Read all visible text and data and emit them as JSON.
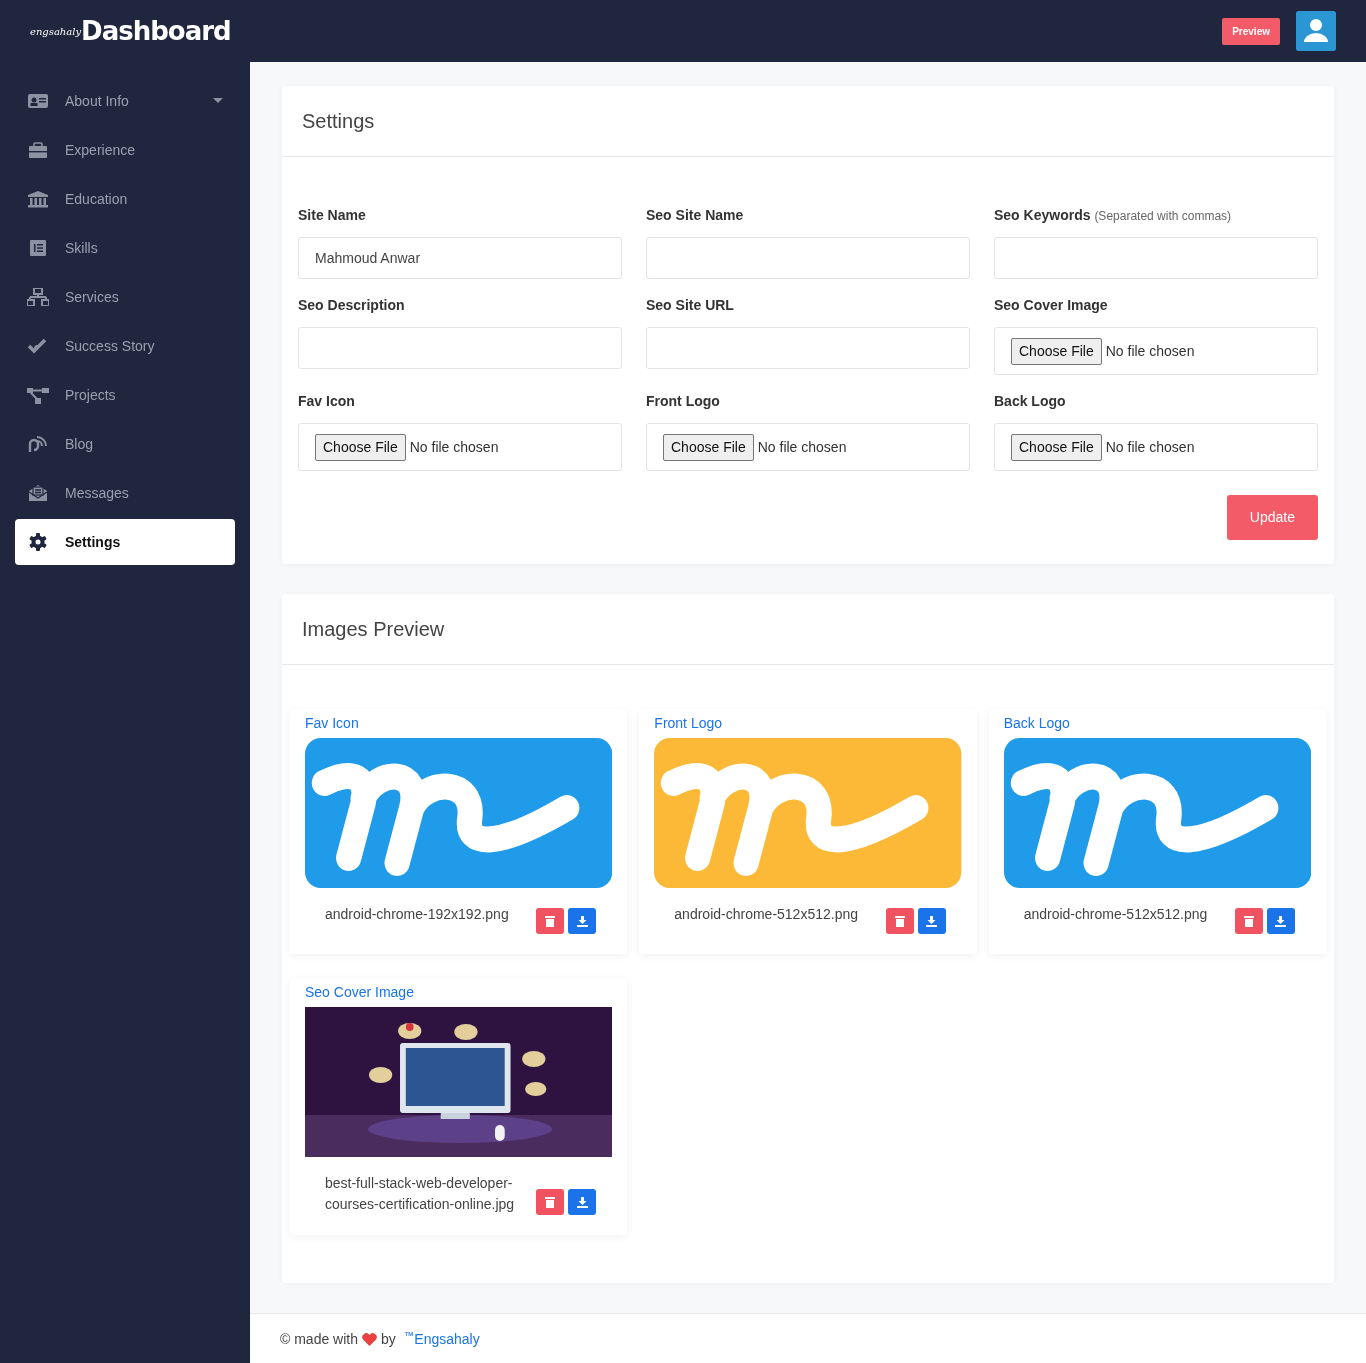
{
  "header": {
    "logo_script": "engsahaly",
    "logo_title": "Dashboard",
    "preview_button": "Preview"
  },
  "sidebar": {
    "items": [
      {
        "label": "About Info",
        "selected": false,
        "has_submenu": true
      },
      {
        "label": "Experience",
        "selected": false,
        "has_submenu": false
      },
      {
        "label": "Education",
        "selected": false,
        "has_submenu": false
      },
      {
        "label": "Skills",
        "selected": false,
        "has_submenu": false
      },
      {
        "label": "Services",
        "selected": false,
        "has_submenu": false
      },
      {
        "label": "Success Story",
        "selected": false,
        "has_submenu": false
      },
      {
        "label": "Projects",
        "selected": false,
        "has_submenu": false
      },
      {
        "label": "Blog",
        "selected": false,
        "has_submenu": false
      },
      {
        "label": "Messages",
        "selected": false,
        "has_submenu": false
      },
      {
        "label": "Settings",
        "selected": true,
        "has_submenu": false
      }
    ]
  },
  "settings": {
    "title": "Settings",
    "fields": [
      {
        "kind": "text",
        "label": "Site Name",
        "value": "Mahmoud Anwar"
      },
      {
        "kind": "text",
        "label": "Seo Site Name"
      },
      {
        "kind": "text",
        "label": "Seo Keywords",
        "hint": "(Separated with commas)"
      },
      {
        "kind": "text",
        "label": "Seo Description"
      },
      {
        "kind": "text",
        "label": "Seo Site URL"
      },
      {
        "kind": "file",
        "label": "Seo Cover Image",
        "button": "Choose File",
        "status": "No file chosen"
      },
      {
        "kind": "file",
        "label": "Fav Icon",
        "button": "Choose File",
        "status": "No file chosen"
      },
      {
        "kind": "file",
        "label": "Front Logo",
        "button": "Choose File",
        "status": "No file chosen"
      },
      {
        "kind": "file",
        "label": "Back Logo",
        "button": "Choose File",
        "status": "No file chosen"
      }
    ],
    "submit": "Update"
  },
  "images_preview": {
    "title": "Images Preview",
    "items": [
      {
        "label": "Fav Icon",
        "kind": "logo",
        "color": "#1f9be9",
        "file_name": "android-chrome-192x192.png"
      },
      {
        "label": "Front Logo",
        "kind": "logo",
        "color": "#fcb937",
        "file_name": "android-chrome-512x512.png"
      },
      {
        "label": "Back Logo",
        "kind": "logo",
        "color": "#1f9be9",
        "file_name": "android-chrome-512x512.png"
      },
      {
        "label": "Seo Cover Image",
        "file_name": "best-full-stack-web-developer-courses-certification-online.jpg"
      }
    ]
  },
  "footer": {
    "prefix": "© made with",
    "by": "by",
    "author": "$^{™}$Engsahaly"
  }
}
